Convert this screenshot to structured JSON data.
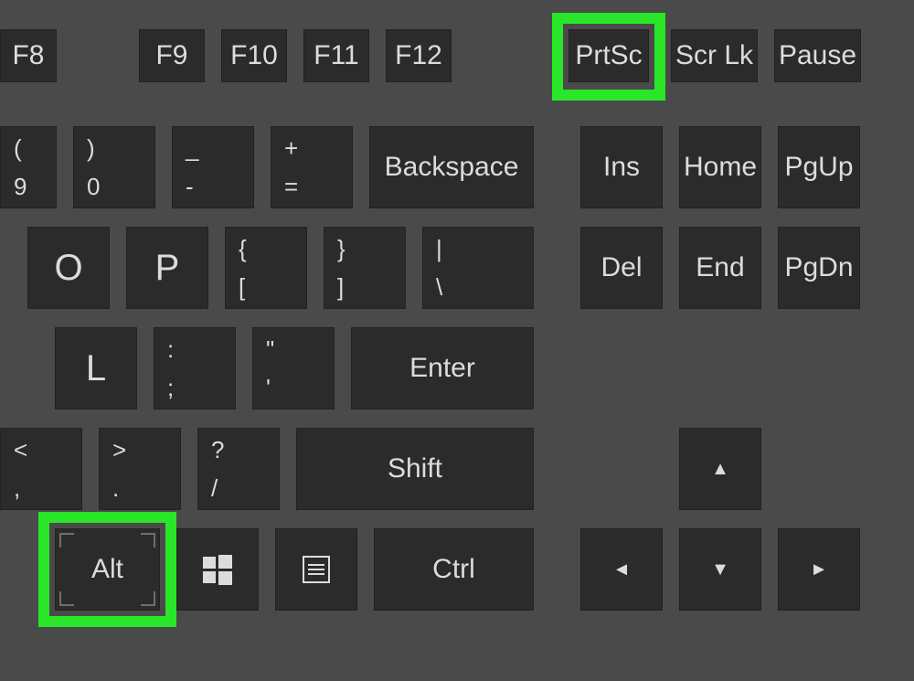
{
  "function_row": {
    "f8": "F8",
    "f9": "F9",
    "f10": "F10",
    "f11": "F11",
    "f12": "F12",
    "prtsc": "PrtSc",
    "scrlk": "Scr Lk",
    "pause": "Pause"
  },
  "number_row": {
    "nine_sub": "(",
    "nine": "9",
    "zero_sub": ")",
    "zero": "0",
    "minus_sub": "_",
    "minus": "-",
    "equals_sub": "+",
    "equals": "=",
    "backspace": "Backspace",
    "ins": "Ins",
    "home": "Home",
    "pgup": "PgUp"
  },
  "qwerty_row": {
    "o": "O",
    "p": "P",
    "lbracket_sub": "{",
    "lbracket": "[",
    "rbracket_sub": "}",
    "rbracket": "]",
    "backslash_sub": "|",
    "backslash": "\\",
    "del": "Del",
    "end": "End",
    "pgdn": "PgDn"
  },
  "home_row": {
    "l": "L",
    "semicolon_sub": ":",
    "semicolon": ";",
    "quote_sub": "\"",
    "quote": "'",
    "enter": "Enter"
  },
  "shift_row": {
    "comma_sub": "<",
    "comma": ",",
    "period_sub": ">",
    "period": ".",
    "slash_sub": "?",
    "slash": "/",
    "shift": "Shift",
    "up": "▲"
  },
  "bottom_row": {
    "alt": "Alt",
    "win": "windows-icon",
    "menu": "menu-icon",
    "ctrl": "Ctrl",
    "left": "◄",
    "down": "▼",
    "right": "►"
  },
  "highlights": [
    "prtsc-key",
    "alt-key"
  ]
}
